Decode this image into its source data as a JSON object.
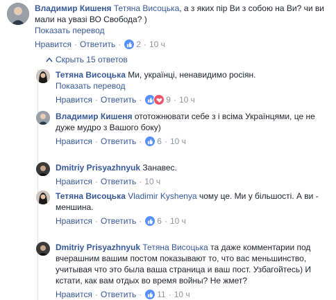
{
  "strings": {
    "like": "Нравится",
    "reply": "Ответить",
    "translate": "Показать перевод",
    "sep": "·"
  },
  "hide_replies": "Скрыть 15 ответов",
  "comments": [
    {
      "author": "Владимир Кишеня",
      "mention": "Тетяна Висоцька",
      "text": ", а з яких пір Ви з собою на Ви? чи ви мали на увазі ВО Свобода? )",
      "show_translate": true,
      "reactions": {
        "icons": [
          "like"
        ],
        "count": "2"
      },
      "time": "10 ч"
    },
    {
      "author": "Тетяна Висоцька",
      "mention": "",
      "text": "Ми, українці, ненавидимо росіян.",
      "show_translate": true,
      "reactions": {
        "icons": [
          "like",
          "love"
        ],
        "count": "9"
      },
      "time": "10 ч"
    },
    {
      "author": "Владимир Кишеня",
      "mention": "",
      "text": "ототожнювати себе з і всіма Українцями, це не дуже мудро з Вашого боку)",
      "show_translate": false,
      "reactions": {
        "icons": [
          "like"
        ],
        "count": "6"
      },
      "time": "10 ч"
    },
    {
      "author": "Dmitriy Prisyazhnyuk",
      "mention": "",
      "text": "Занавес.",
      "show_translate": false,
      "reactions": null,
      "time": "10 ч"
    },
    {
      "author": "Тетяна Висоцька",
      "mention": "Vladimir Kyshenya",
      "text": "чому це. Ми у більшості. А ви - меншина.",
      "show_translate": false,
      "reactions": {
        "icons": [
          "like"
        ],
        "count": "6"
      },
      "time": "10 ч"
    },
    {
      "author": "Dmitriy Prisyazhnyuk",
      "mention": "Тетяна Висоцька",
      "text": "та даже комментарии под вчерашним вашим постом показывают то, что вас меньшинство, учитывая что это была ваша страница и ваш пост. Узбагойтесь) И кстати, как вам отдых во время войны? Не жмет?",
      "show_translate": false,
      "reactions": {
        "icons": [
          "like"
        ],
        "count": "11"
      },
      "time": "10 ч"
    }
  ],
  "colors": {
    "link": "#365899",
    "meta": "#90949c",
    "like": "#5890ff",
    "love": "#f25268"
  }
}
